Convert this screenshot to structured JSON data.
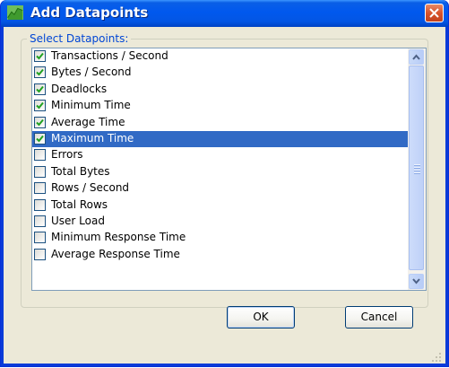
{
  "window": {
    "title": "Add Datapoints",
    "icon": "chart-icon"
  },
  "group": {
    "label": "Select Datapoints:"
  },
  "datapoints": [
    {
      "label": "Transactions / Second",
      "checked": true,
      "selected": false
    },
    {
      "label": "Bytes / Second",
      "checked": true,
      "selected": false
    },
    {
      "label": "Deadlocks",
      "checked": true,
      "selected": false
    },
    {
      "label": "Minimum Time",
      "checked": true,
      "selected": false
    },
    {
      "label": "Average Time",
      "checked": true,
      "selected": false
    },
    {
      "label": "Maximum Time",
      "checked": true,
      "selected": true
    },
    {
      "label": "Errors",
      "checked": false,
      "selected": false
    },
    {
      "label": "Total Bytes",
      "checked": false,
      "selected": false
    },
    {
      "label": "Rows / Second",
      "checked": false,
      "selected": false
    },
    {
      "label": "Total Rows",
      "checked": false,
      "selected": false
    },
    {
      "label": "User Load",
      "checked": false,
      "selected": false
    },
    {
      "label": "Minimum Response Time",
      "checked": false,
      "selected": false
    },
    {
      "label": "Average Response Time",
      "checked": false,
      "selected": false
    }
  ],
  "buttons": {
    "ok": "OK",
    "cancel": "Cancel"
  },
  "colors": {
    "title_bar": "#0058ee",
    "selection": "#316ac5",
    "group_label": "#0046d5",
    "checkmark": "#21a121"
  }
}
